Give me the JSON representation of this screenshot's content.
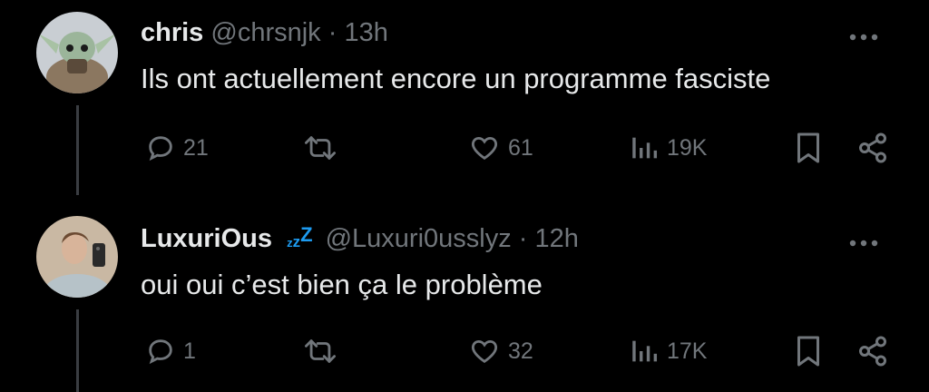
{
  "tweets": [
    {
      "name": "chris",
      "handle": "@chrsnjk",
      "separator": "·",
      "time": "13h",
      "text": "Ils ont actuellement encore un programme fasciste",
      "replies": "21",
      "reposts": "",
      "likes": "61",
      "views": "19K"
    },
    {
      "name": "LuxuriOus",
      "badge_text": "zzZ",
      "handle": "@Luxuri0usslyz",
      "separator": "·",
      "time": "12h",
      "text": "oui oui c’est bien ça le problème",
      "replies": "1",
      "reposts": "",
      "likes": "32",
      "views": "17K"
    }
  ],
  "colors": {
    "background": "#000000",
    "text_primary": "#e7e9ea",
    "text_secondary": "#71767b",
    "accent": "#1d9bf0"
  },
  "icons": [
    "more-icon",
    "reply-icon",
    "repost-icon",
    "like-icon",
    "views-icon",
    "bookmark-icon",
    "share-icon"
  ]
}
